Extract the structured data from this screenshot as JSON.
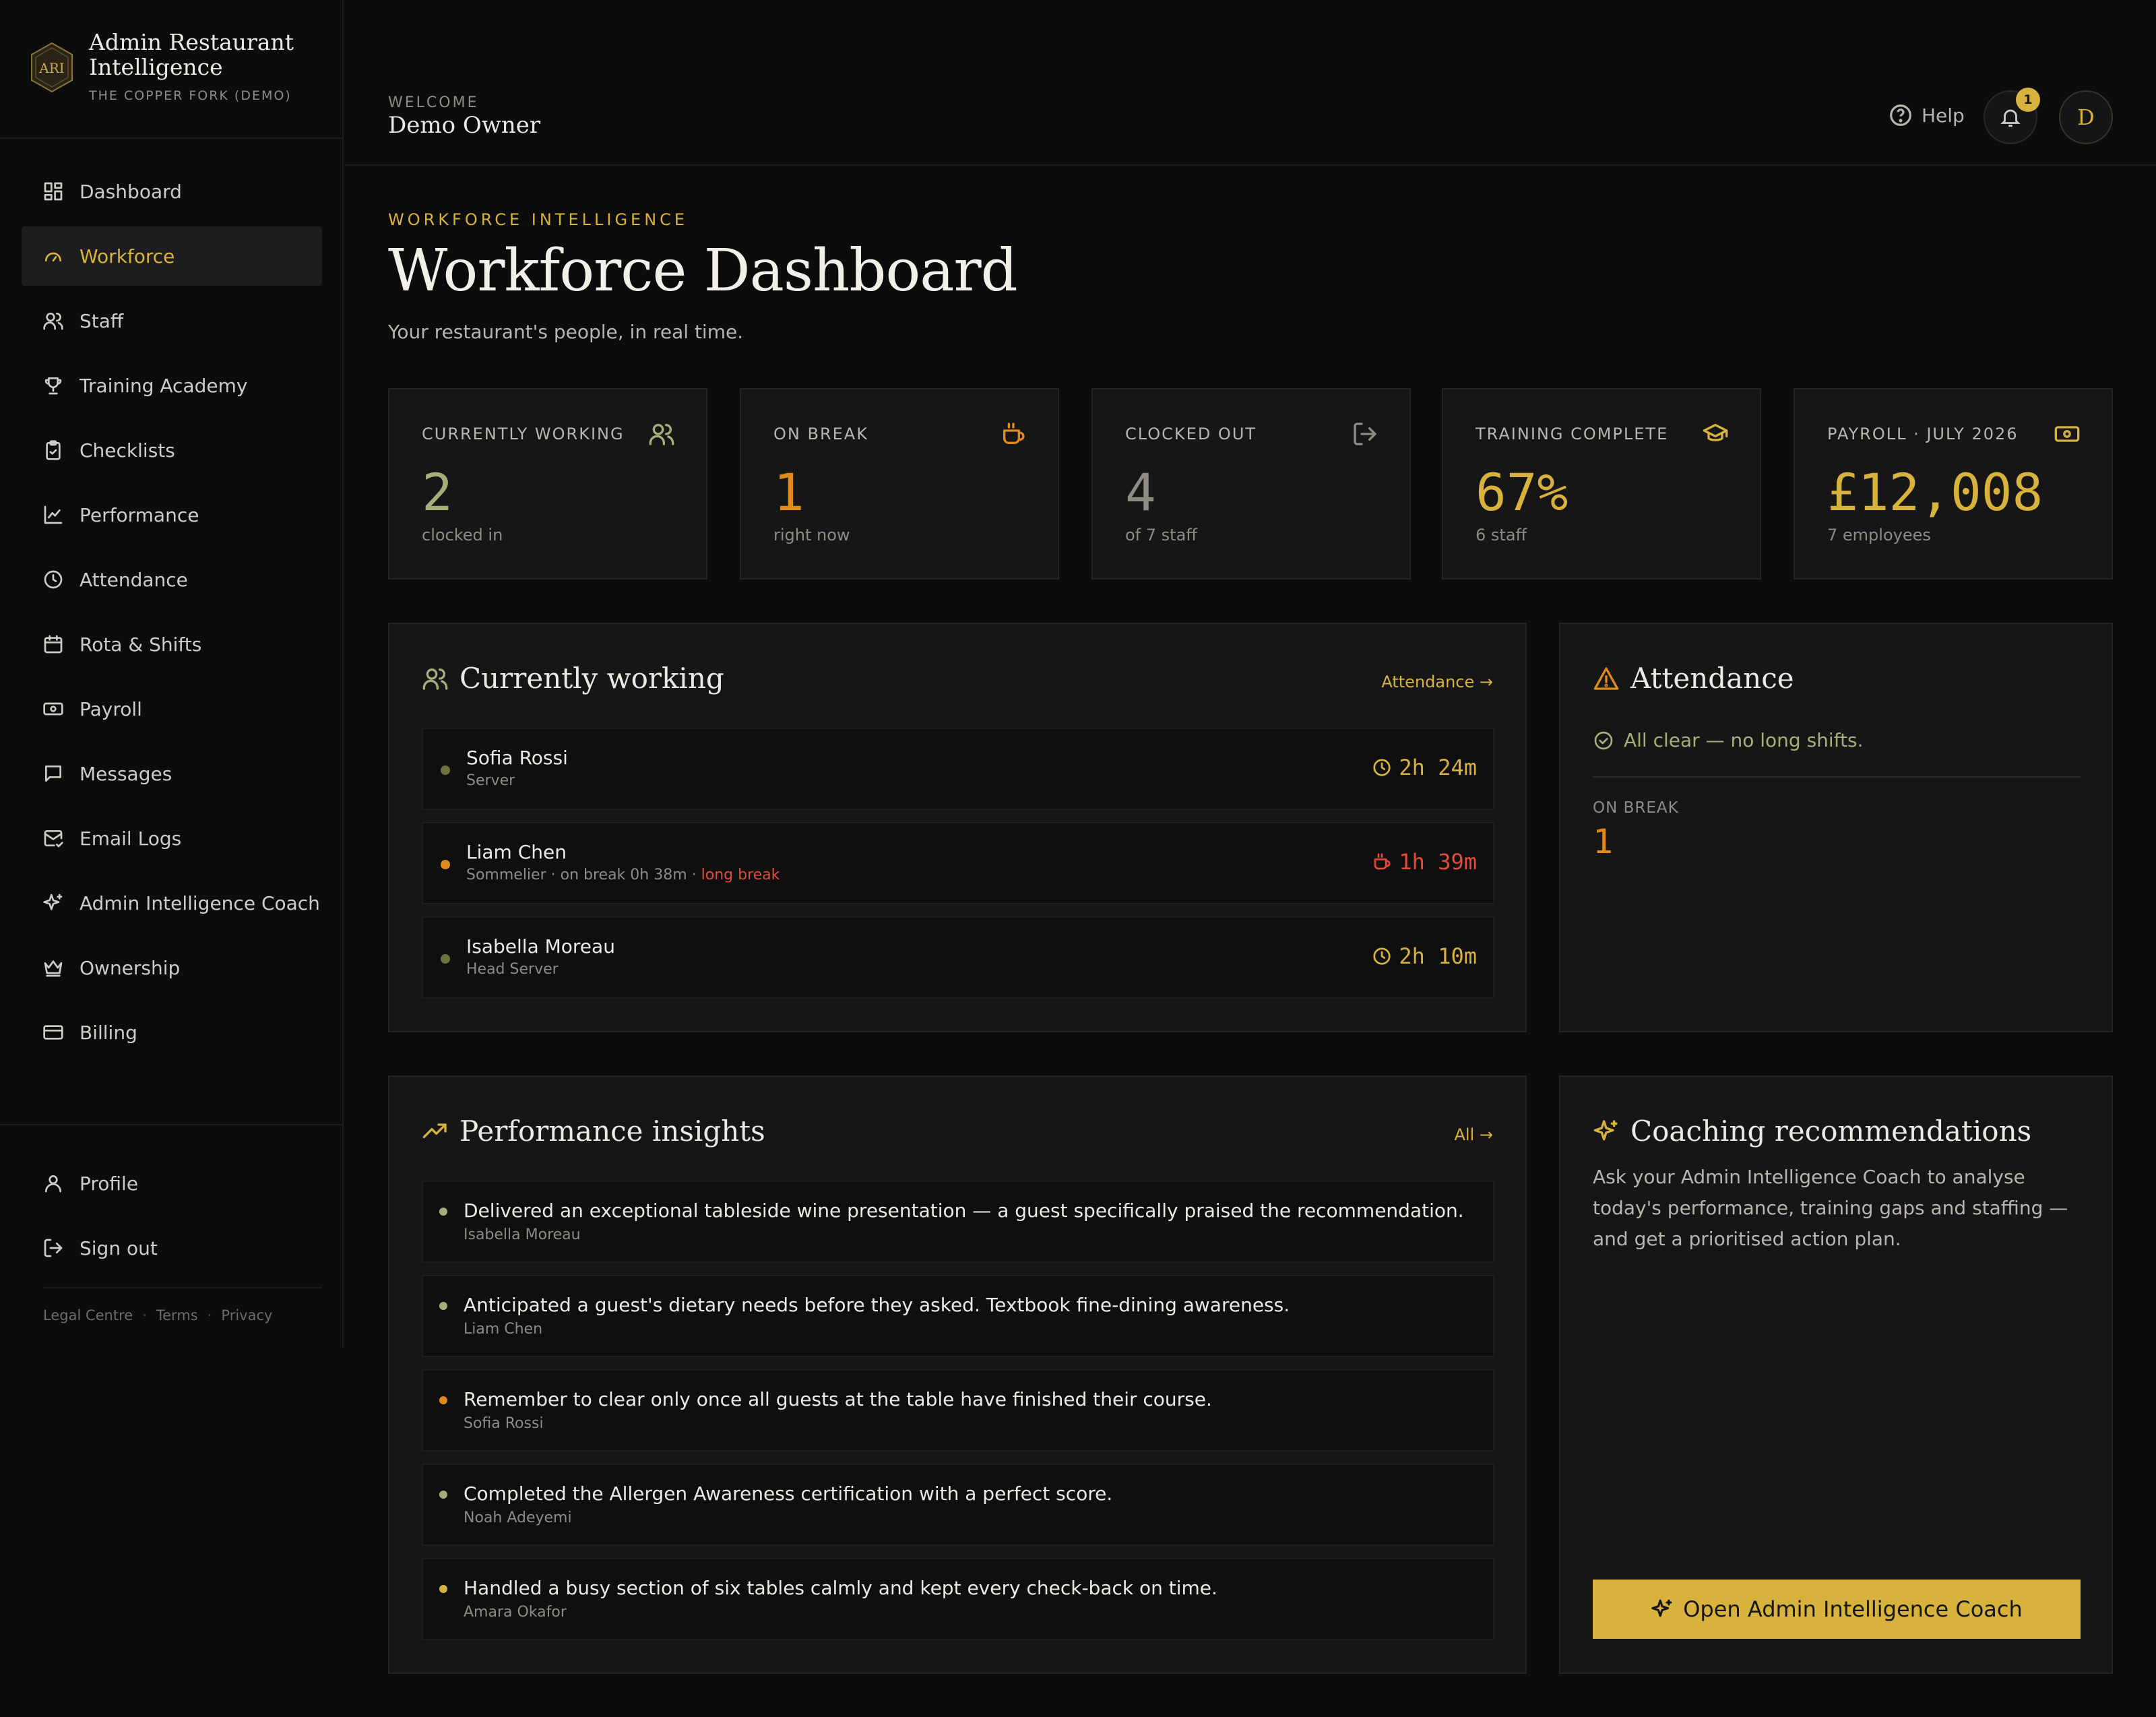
{
  "brand": {
    "title": "Admin Restaurant Intelligence",
    "subtitle": "THE COPPER FORK (DEMO)",
    "monogram": "ARI"
  },
  "sidebar": {
    "items": [
      {
        "label": "Dashboard",
        "icon": "dashboard-icon"
      },
      {
        "label": "Workforce",
        "icon": "gauge-icon",
        "active": true
      },
      {
        "label": "Staff",
        "icon": "users-icon"
      },
      {
        "label": "Training Academy",
        "icon": "trophy-icon"
      },
      {
        "label": "Checklists",
        "icon": "clipboard-check-icon"
      },
      {
        "label": "Performance",
        "icon": "line-chart-icon"
      },
      {
        "label": "Attendance",
        "icon": "clock-icon"
      },
      {
        "label": "Rota & Shifts",
        "icon": "calendar-icon"
      },
      {
        "label": "Payroll",
        "icon": "banknote-icon"
      },
      {
        "label": "Messages",
        "icon": "message-icon"
      },
      {
        "label": "Email Logs",
        "icon": "mail-check-icon"
      },
      {
        "label": "Admin Intelligence Coach",
        "icon": "sparkles-icon"
      },
      {
        "label": "Ownership",
        "icon": "crown-icon"
      },
      {
        "label": "Billing",
        "icon": "credit-card-icon"
      }
    ],
    "bottom": [
      {
        "label": "Profile",
        "icon": "user-icon"
      },
      {
        "label": "Sign out",
        "icon": "sign-out-icon"
      }
    ],
    "legal": [
      "Legal Centre",
      "Terms",
      "Privacy"
    ]
  },
  "topbar": {
    "welcome_label": "WELCOME",
    "user_name": "Demo Owner",
    "help_label": "Help",
    "notification_count": "1",
    "avatar_initial": "D"
  },
  "page": {
    "eyebrow": "WORKFORCE INTELLIGENCE",
    "title": "Workforce Dashboard",
    "subtitle": "Your restaurant's people, in real time."
  },
  "stats": [
    {
      "label": "CURRENTLY WORKING",
      "value": "2",
      "note": "clocked in",
      "icon": "users-icon",
      "color": "#a8ad7a"
    },
    {
      "label": "ON BREAK",
      "value": "1",
      "note": "right now",
      "icon": "coffee-icon",
      "color": "#e08a1e"
    },
    {
      "label": "CLOCKED OUT",
      "value": "4",
      "note": "of 7 staff",
      "icon": "sign-out-icon",
      "color": "#8f8b82"
    },
    {
      "label": "TRAINING COMPLETE",
      "value": "67%",
      "note": "6 staff",
      "icon": "graduation-cap-icon",
      "color": "#d7b23d"
    },
    {
      "label": "PAYROLL · JULY 2026",
      "value": "£12,008",
      "note": "7 employees",
      "icon": "banknote-icon",
      "color": "#d7b23d"
    }
  ],
  "working": {
    "title": "Currently working",
    "link": "Attendance",
    "rows": [
      {
        "name": "Sofia Rossi",
        "role": "Server",
        "time": "2h 24m",
        "status": "working",
        "dot": "#6e7040",
        "time_color": "#d7b23d"
      },
      {
        "name": "Liam Chen",
        "role": "Sommelier · on break 0h 38m · ",
        "warning": "long break",
        "time": "1h 39m",
        "status": "break",
        "dot": "#e08a1e",
        "time_color": "#e04b3a"
      },
      {
        "name": "Isabella Moreau",
        "role": "Head Server",
        "time": "2h 10m",
        "status": "working",
        "dot": "#6e7040",
        "time_color": "#d7b23d"
      }
    ]
  },
  "attendance": {
    "title": "Attendance",
    "all_clear": "All clear — no long shifts.",
    "on_break_label": "ON BREAK",
    "on_break_value": "1"
  },
  "insights": {
    "title": "Performance insights",
    "link": "All",
    "items": [
      {
        "text": "Delivered an exceptional tableside wine presentation — a guest specifically praised the recommendation.",
        "name": "Isabella Moreau",
        "dot": "#a8ad7a"
      },
      {
        "text": "Anticipated a guest's dietary needs before they asked. Textbook fine-dining awareness.",
        "name": "Liam Chen",
        "dot": "#a8ad7a"
      },
      {
        "text": "Remember to clear only once all guests at the table have finished their course.",
        "name": "Sofia Rossi",
        "dot": "#e08a1e"
      },
      {
        "text": "Completed the Allergen Awareness certification with a perfect score.",
        "name": "Noah Adeyemi",
        "dot": "#a8ad7a"
      },
      {
        "text": "Handled a busy section of six tables calmly and kept every check-back on time.",
        "name": "Amara Okafor",
        "dot": "#d7b23d"
      }
    ]
  },
  "coach": {
    "title": "Coaching recommendations",
    "body": "Ask your Admin Intelligence Coach to analyse today's performance, training gaps and staffing — and get a prioritised action plan.",
    "button": "Open Admin Intelligence Coach"
  },
  "colors": {
    "accent": "#d7b23d",
    "warning": "#e04b3a",
    "break": "#e08a1e",
    "olive": "#a8ad7a"
  }
}
